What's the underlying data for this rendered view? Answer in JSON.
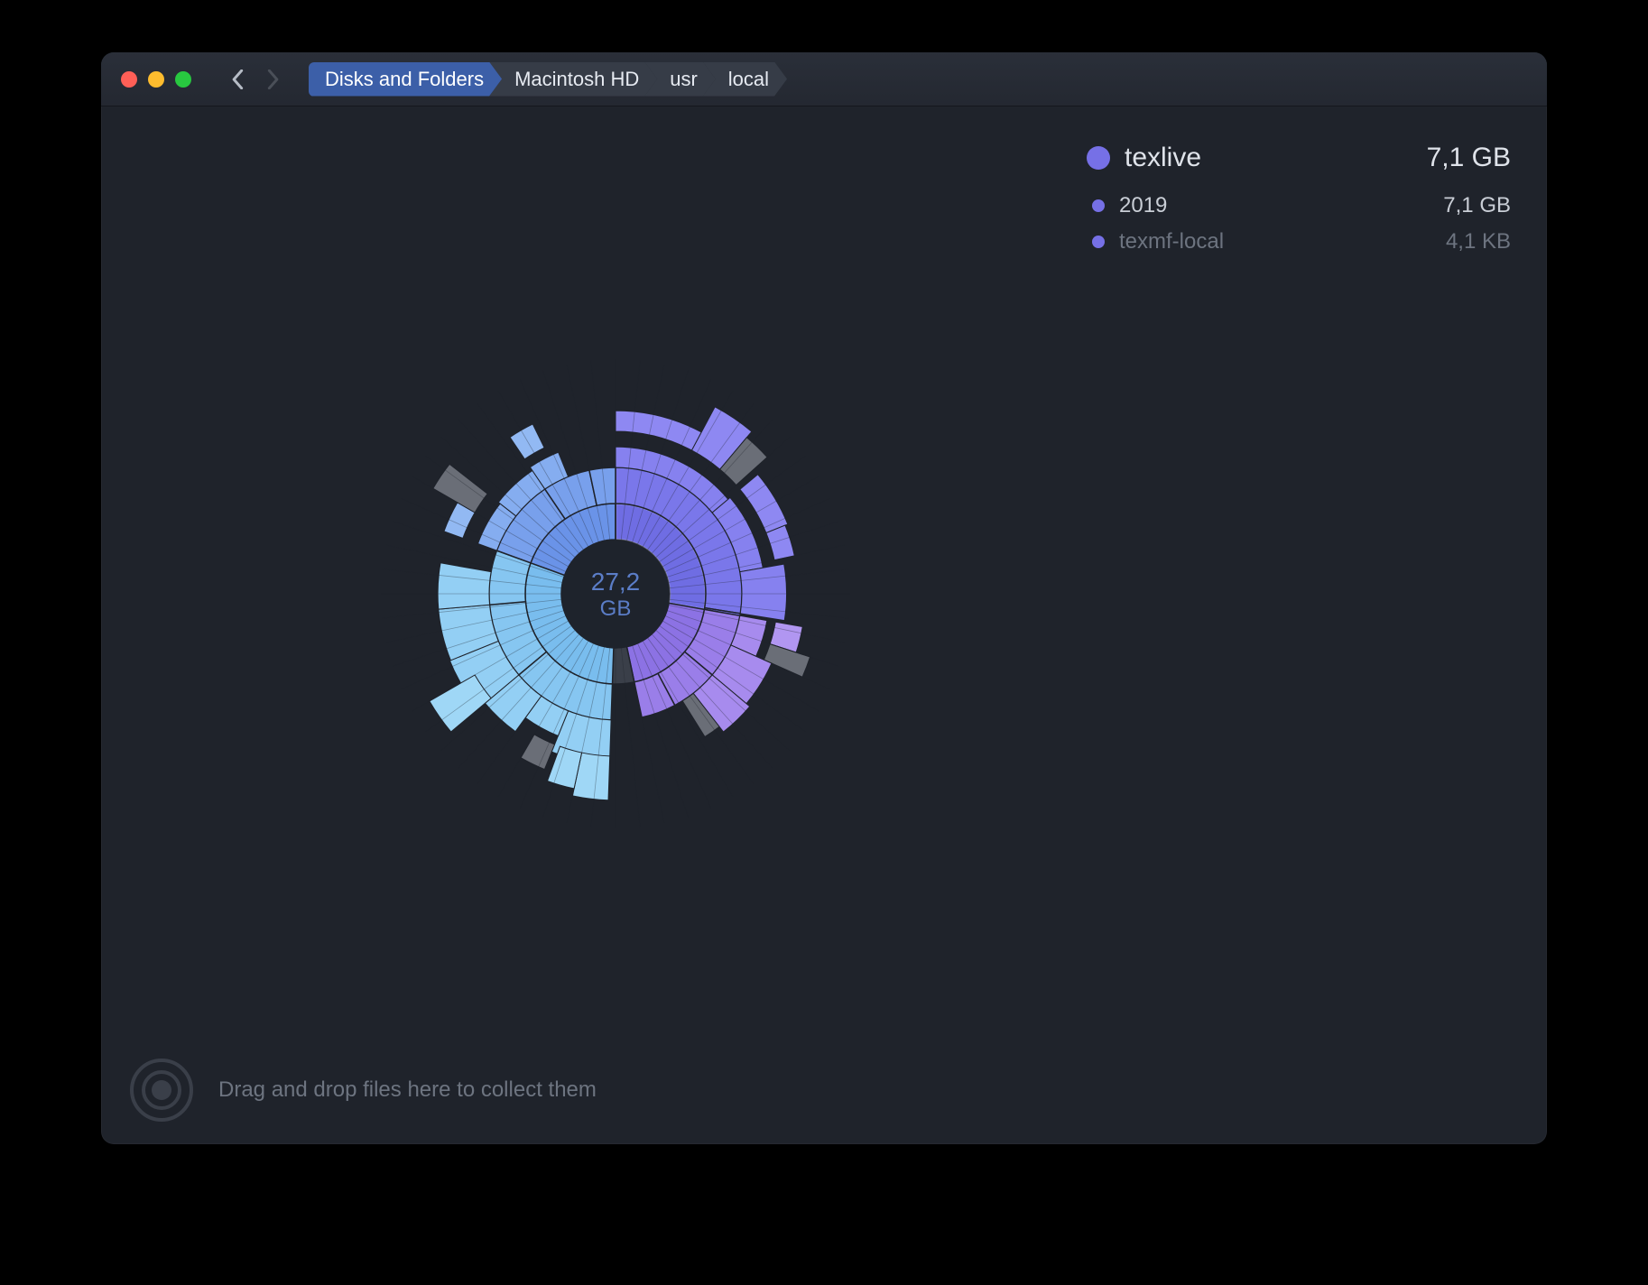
{
  "breadcrumbs": [
    "Disks and Folders",
    "Macintosh HD",
    "usr",
    "local"
  ],
  "selection": {
    "name": "texlive",
    "size": "7,1 GB",
    "color": "#7670e6",
    "children": [
      {
        "name": "2019",
        "size": "7,1 GB",
        "dim": false
      },
      {
        "name": "texmf-local",
        "size": "4,1  KB",
        "dim": true
      }
    ]
  },
  "center": {
    "value": "27,2",
    "unit": "GB"
  },
  "footer_hint": "Drag and drop files here to collect them",
  "chart_data": {
    "type": "sunburst",
    "total_label": "27,2 GB",
    "highlighted_path": [
      "texlive"
    ],
    "rings": 5,
    "radii": {
      "r0": 60,
      "ring": 40
    },
    "sectors": [
      {
        "name": "texlive",
        "start": -90,
        "end": 10,
        "depth": 1,
        "color": "#6f6de3",
        "highlight": true,
        "children": [
          {
            "name": "2019",
            "start": -90,
            "end": 9,
            "depth": 2,
            "color": "#7a77ea",
            "children": [
              {
                "start": -90,
                "end": -40,
                "depth": 3,
                "color": "#8681ef",
                "children": [
                  {
                    "start": -90,
                    "end": -62,
                    "depth": 4,
                    "color": "#8e88f2"
                  },
                  {
                    "start": -62,
                    "end": -50,
                    "depth": 4,
                    "color": "#8e88f2"
                  },
                  {
                    "start": -50,
                    "end": -42,
                    "depth": 4,
                    "color": "#6a6e77"
                  }
                ]
              },
              {
                "start": -40,
                "end": -10,
                "depth": 3,
                "color": "#8681ef",
                "children": [
                  {
                    "start": -40,
                    "end": -22,
                    "depth": 4,
                    "color": "#8e88f2"
                  },
                  {
                    "start": -22,
                    "end": -12,
                    "depth": 4,
                    "color": "#8e88f2"
                  }
                ]
              },
              {
                "start": -10,
                "end": 9,
                "depth": 3,
                "color": "#8681ef"
              }
            ]
          },
          {
            "name": "texmf-local",
            "start": 9,
            "end": 10,
            "depth": 2,
            "color": "#7a77ea"
          }
        ]
      },
      {
        "name": "seg-violet",
        "start": 10,
        "end": 78,
        "depth": 1,
        "color": "#8c72e4",
        "children": [
          {
            "start": 10,
            "end": 40,
            "depth": 2,
            "color": "#9a7ee9",
            "children": [
              {
                "start": 10,
                "end": 24,
                "depth": 3,
                "color": "#a78bee",
                "children": [
                  {
                    "start": 10,
                    "end": 18,
                    "depth": 4,
                    "color": "#b196f1"
                  },
                  {
                    "start": 18,
                    "end": 24,
                    "depth": 4,
                    "color": "#6a6e77"
                  }
                ]
              },
              {
                "start": 24,
                "end": 40,
                "depth": 3,
                "color": "#a78bee"
              }
            ]
          },
          {
            "start": 40,
            "end": 62,
            "depth": 2,
            "color": "#9a7ee9",
            "children": [
              {
                "start": 40,
                "end": 52,
                "depth": 3,
                "color": "#a78bee"
              },
              {
                "start": 52,
                "end": 58,
                "depth": 3,
                "color": "#6a6e77"
              }
            ]
          },
          {
            "start": 62,
            "end": 78,
            "depth": 2,
            "color": "#9a7ee9"
          }
        ]
      },
      {
        "name": "free-a",
        "start": 78,
        "end": 92,
        "depth": 1,
        "color": "#3a3f49",
        "free": true
      },
      {
        "name": "seg-sky",
        "start": 92,
        "end": 200,
        "depth": 1,
        "color": "#79bdee",
        "children": [
          {
            "start": 92,
            "end": 140,
            "depth": 2,
            "color": "#86c6f1",
            "children": [
              {
                "start": 92,
                "end": 112,
                "depth": 3,
                "color": "#93cff4",
                "children": [
                  {
                    "start": 92,
                    "end": 102,
                    "depth": 4,
                    "color": "#9fd7f6"
                  },
                  {
                    "start": 102,
                    "end": 110,
                    "depth": 4,
                    "color": "#9fd7f6"
                  }
                ]
              },
              {
                "start": 112,
                "end": 126,
                "depth": 3,
                "color": "#93cff4",
                "children": [
                  {
                    "start": 112,
                    "end": 120,
                    "depth": 4,
                    "color": "#6a6e77"
                  }
                ]
              },
              {
                "start": 126,
                "end": 140,
                "depth": 3,
                "color": "#93cff4"
              }
            ]
          },
          {
            "start": 140,
            "end": 175,
            "depth": 2,
            "color": "#86c6f1",
            "children": [
              {
                "start": 140,
                "end": 158,
                "depth": 3,
                "color": "#93cff4",
                "children": [
                  {
                    "start": 140,
                    "end": 150,
                    "depth": 4,
                    "color": "#9fd7f6"
                  }
                ]
              },
              {
                "start": 158,
                "end": 175,
                "depth": 3,
                "color": "#93cff4"
              }
            ]
          },
          {
            "start": 175,
            "end": 200,
            "depth": 2,
            "color": "#86c6f1",
            "children": [
              {
                "start": 175,
                "end": 190,
                "depth": 3,
                "color": "#93cff4"
              }
            ]
          }
        ]
      },
      {
        "name": "seg-blue",
        "start": 200,
        "end": 270,
        "depth": 1,
        "color": "#6a93e8",
        "children": [
          {
            "start": 200,
            "end": 236,
            "depth": 2,
            "color": "#78a0ec",
            "children": [
              {
                "start": 200,
                "end": 218,
                "depth": 3,
                "color": "#85adf0",
                "children": [
                  {
                    "start": 200,
                    "end": 210,
                    "depth": 4,
                    "color": "#92b9f3"
                  },
                  {
                    "start": 210,
                    "end": 218,
                    "depth": 4,
                    "color": "#6a6e77"
                  }
                ]
              },
              {
                "start": 218,
                "end": 236,
                "depth": 3,
                "color": "#85adf0"
              }
            ]
          },
          {
            "start": 236,
            "end": 258,
            "depth": 2,
            "color": "#78a0ec",
            "children": [
              {
                "start": 236,
                "end": 248,
                "depth": 3,
                "color": "#85adf0",
                "children": [
                  {
                    "start": 236,
                    "end": 244,
                    "depth": 4,
                    "color": "#92b9f3"
                  }
                ]
              }
            ]
          },
          {
            "start": 258,
            "end": 270,
            "depth": 2,
            "color": "#78a0ec"
          }
        ]
      },
      {
        "name": "free-b",
        "start": 270,
        "end": 270,
        "depth": 1,
        "color": "#3a3f49",
        "free": true
      }
    ]
  }
}
